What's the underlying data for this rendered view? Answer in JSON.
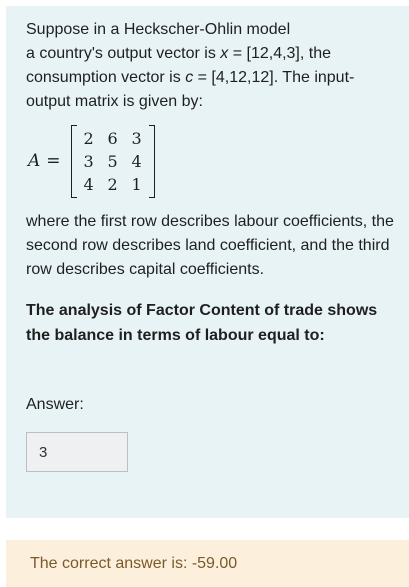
{
  "question": {
    "intro_line1": "Suppose in a Heckscher-Ohlin model",
    "intro_line2_pre": "a country's output vector is ",
    "intro_output_var": "x",
    "intro_output_value": " = [12,4,3], the",
    "intro_line3_pre": "consumption vector is ",
    "intro_consumption_var": "c",
    "intro_consumption_value": " = [4,12,12]. The input-",
    "intro_line4": "output matrix is given by:",
    "matrix_label": "A",
    "matrix_eq": "=",
    "matrix": [
      [
        "2",
        "6",
        "3"
      ],
      [
        "3",
        "5",
        "4"
      ],
      [
        "4",
        "2",
        "1"
      ]
    ],
    "description": "where the first row describes labour coefficients, the second row describes land coefficient, and the third row describes capital coefficients.",
    "prompt": "The analysis of Factor Content of trade shows the balance in terms of labour equal to:",
    "answer_label": "Answer:",
    "answer_value": "3"
  },
  "feedback": {
    "correct_answer_text": "The correct answer is: -59.00"
  }
}
